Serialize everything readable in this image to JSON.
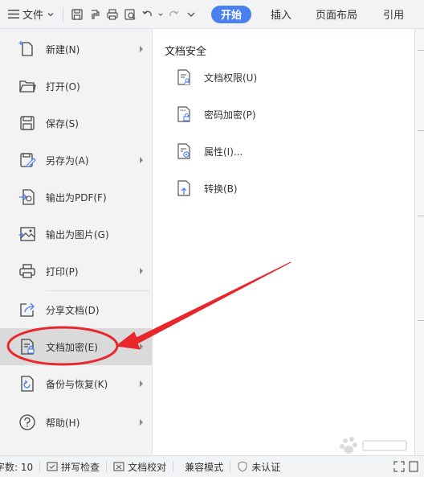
{
  "toolbar": {
    "file_label": "文件",
    "tabs": [
      {
        "label": "开始",
        "active": true
      },
      {
        "label": "插入"
      },
      {
        "label": "页面布局"
      },
      {
        "label": "引用"
      }
    ],
    "accent_color": "#4a80f0"
  },
  "file_menu": {
    "items": [
      {
        "label": "新建(N)",
        "icon": "new-doc-icon",
        "has_submenu": true
      },
      {
        "label": "打开(O)",
        "icon": "folder-open-icon",
        "has_submenu": false
      },
      {
        "label": "保存(S)",
        "icon": "save-icon",
        "has_submenu": false
      },
      {
        "label": "另存为(A)",
        "icon": "save-as-icon",
        "has_submenu": true
      },
      {
        "label": "输出为PDF(F)",
        "icon": "export-pdf-icon",
        "has_submenu": false
      },
      {
        "label": "输出为图片(G)",
        "icon": "export-image-icon",
        "has_submenu": false
      },
      {
        "label": "打印(P)",
        "icon": "print-icon",
        "has_submenu": true
      },
      {
        "label": "分享文档(D)",
        "icon": "share-icon",
        "has_submenu": false
      },
      {
        "label": "文档加密(E)",
        "icon": "doc-encrypt-icon",
        "has_submenu": true,
        "highlighted": true
      },
      {
        "label": "备份与恢复(K)",
        "icon": "backup-restore-icon",
        "has_submenu": true
      },
      {
        "label": "帮助(H)",
        "icon": "help-icon",
        "has_submenu": true
      }
    ]
  },
  "submenu": {
    "title": "文档安全",
    "items": [
      {
        "label": "文档权限(U)",
        "icon": "doc-permission-icon"
      },
      {
        "label": "密码加密(P)",
        "icon": "password-encrypt-icon"
      },
      {
        "label": "属性(I)...",
        "icon": "properties-icon"
      },
      {
        "label": "转换(B)",
        "icon": "convert-icon"
      }
    ]
  },
  "status_bar": {
    "word_count_label": "字数: 10",
    "spell_check": "拼写检查",
    "doc_proofread": "文档校对",
    "compat_mode": "兼容模式",
    "unverified": "未认证"
  },
  "annotation": {
    "highlight_color": "#e8262b"
  }
}
